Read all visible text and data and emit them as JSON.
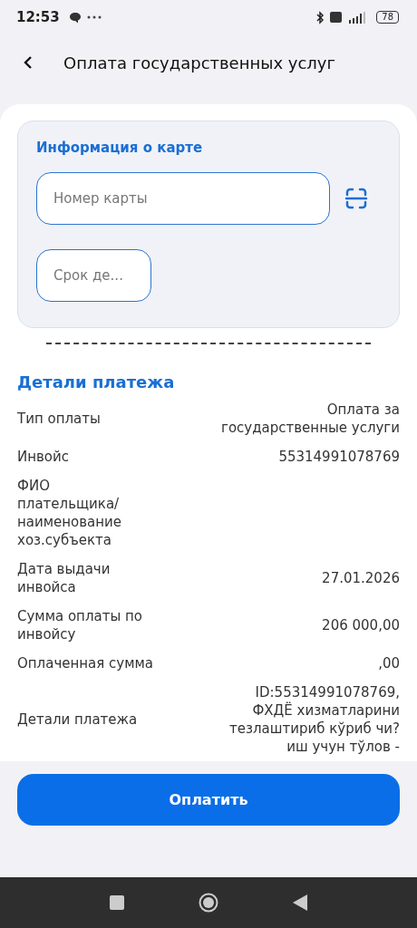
{
  "status_bar": {
    "time": "12:53",
    "battery": "78"
  },
  "header": {
    "title": "Оплата государственных услуг"
  },
  "card_info": {
    "title": "Информация о карте",
    "card_number": {
      "placeholder": "Номер карты"
    },
    "expiry": {
      "placeholder": "Срок де..."
    }
  },
  "details": {
    "title": "Детали платежа",
    "rows": [
      {
        "label": "Тип оплаты",
        "value": "Оплата за государственные услуги"
      },
      {
        "label": "Инвойс",
        "value": "55314991078769"
      },
      {
        "label": "ФИО плательщика/ наименование хоз.субъекта"
      },
      {
        "label": "Дата выдачи инвойса",
        "value": "27.01.2026"
      },
      {
        "label": "Сумма оплаты по инвойсу",
        "value": "206 000,00"
      },
      {
        "label": "Оплаченная сумма",
        "value": ",00"
      },
      {
        "label": "Детали платежа",
        "value": "ID:55314991078769, ФХДЁ хизматларини тезлаштириб кўриб чи?иш учун тўлов -"
      }
    ]
  },
  "pay_button": "Оплатить"
}
